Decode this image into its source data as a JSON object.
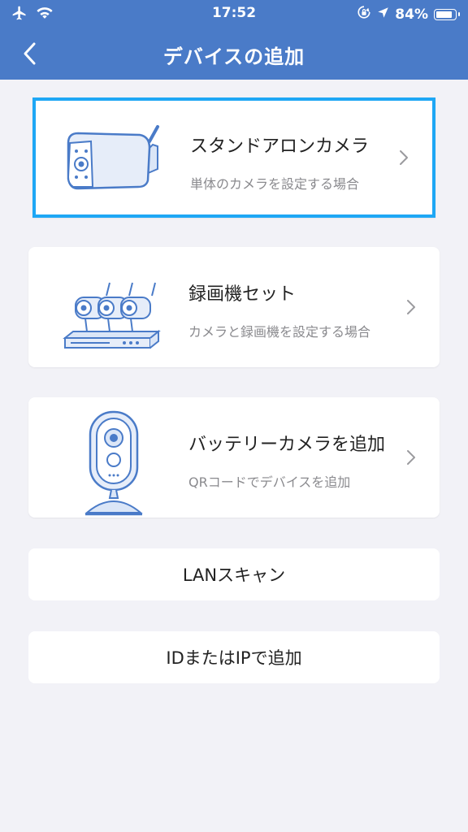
{
  "status": {
    "time": "17:52",
    "battery": "84%"
  },
  "nav": {
    "title": "デバイスの追加"
  },
  "cards": [
    {
      "title": "スタンドアロンカメラ",
      "subtitle": "単体のカメラを設定する場合"
    },
    {
      "title": "録画機セット",
      "subtitle": "カメラと録画機を設定する場合"
    },
    {
      "title": "バッテリーカメラを追加",
      "subtitle": "QRコードでデバイスを追加"
    }
  ],
  "buttons": {
    "lan_scan": "LANスキャン",
    "add_by_id": "IDまたはIPで追加"
  },
  "colors": {
    "header": "#4a7bc8",
    "selection": "#1ea7f5",
    "background": "#f2f2f7"
  }
}
